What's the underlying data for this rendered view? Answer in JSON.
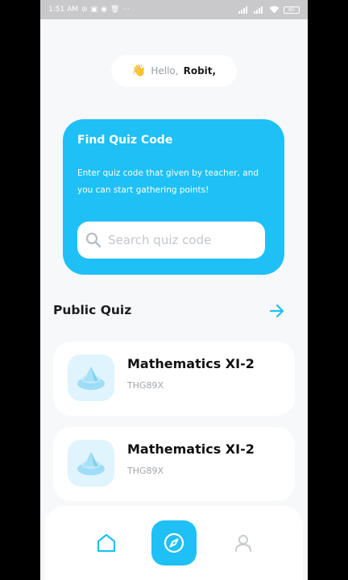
{
  "status_bar": {
    "time": "1:51 AM",
    "more": "···",
    "battery": "85"
  },
  "greeting": {
    "emoji": "👋",
    "hello": "Hello,",
    "name": "Robit,"
  },
  "find_quiz": {
    "title": "Find Quiz Code",
    "description": "Enter quiz code that given by teacher, and you can start gathering points!",
    "search_placeholder": "Search quiz code",
    "search_value": ""
  },
  "public_quiz": {
    "title": "Public Quiz",
    "items": [
      {
        "title": "Mathematics XI-2",
        "code": "THG89X"
      },
      {
        "title": "Mathematics XI-2",
        "code": "THG89X"
      }
    ]
  },
  "colors": {
    "accent": "#1fc0f5",
    "icon_bg": "#dff4fd",
    "background": "#f7f8fa"
  },
  "nav": {
    "items": [
      "home-icon",
      "compass-icon",
      "profile-icon"
    ],
    "active": "compass-icon"
  }
}
